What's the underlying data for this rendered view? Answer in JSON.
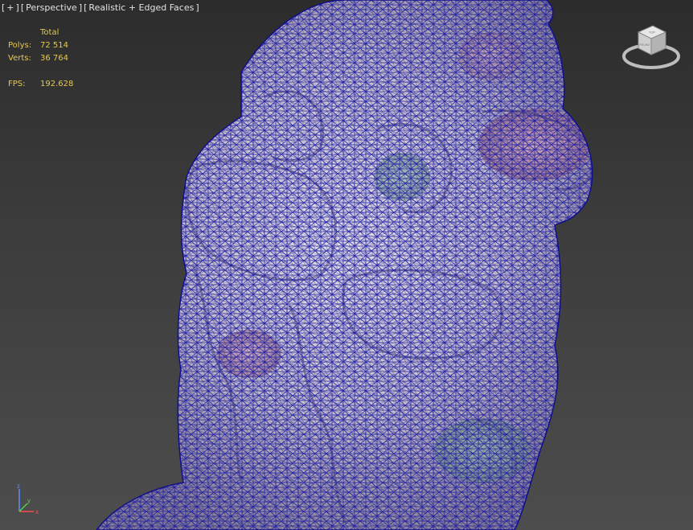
{
  "viewport": {
    "labels": {
      "plus": "+",
      "view": "Perspective",
      "shading": "Realistic + Edged Faces"
    }
  },
  "stats": {
    "header": "Total",
    "polys_label": "Polys:",
    "polys_value": "72 514",
    "verts_label": "Verts:",
    "verts_value": "36 764",
    "fps_label": "FPS:",
    "fps_value": "192.628"
  },
  "viewcube": {
    "top_face": "TOP",
    "front_face": "FRONT"
  },
  "axis": {
    "x": "x",
    "y": "y",
    "z": "z"
  },
  "colors": {
    "wireframe": "#1a1aa8",
    "stats_text": "#e8c84a",
    "label_text": "#e2e2e2",
    "background_top": "#2c2c2c",
    "background_bottom": "#4d4d4d"
  }
}
